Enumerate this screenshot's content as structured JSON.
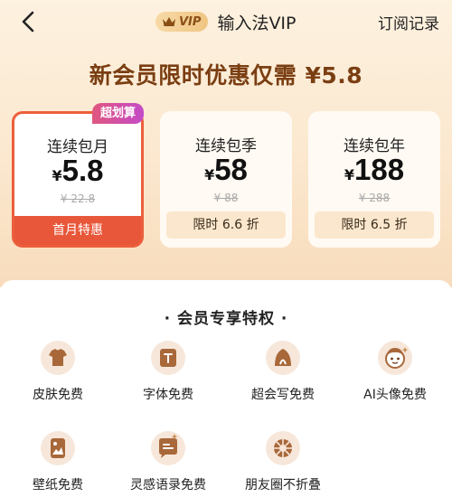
{
  "nav": {
    "vip_badge": "VIP",
    "title": "输入法VIP",
    "right_link": "订阅记录"
  },
  "headline": "新会员限时优惠仅需 ¥5.8",
  "plans": [
    {
      "name": "连续包月",
      "currency": "¥",
      "price": "5.8",
      "original": "¥ 22.8",
      "tag": "首月特惠",
      "ribbon": "超划算",
      "selected": true
    },
    {
      "name": "连续包季",
      "currency": "¥",
      "price": "58",
      "original": "¥ 88",
      "tag": "限时 6.6 折",
      "selected": false
    },
    {
      "name": "连续包年",
      "currency": "¥",
      "price": "188",
      "original": "¥ 288",
      "tag": "限时 6.5 折",
      "selected": false
    }
  ],
  "benefits_title": "· 会员专享特权 ·",
  "benefits": [
    {
      "label": "皮肤免费",
      "icon": "tshirt-icon"
    },
    {
      "label": "字体免费",
      "icon": "font-icon"
    },
    {
      "label": "超会写免费",
      "icon": "writing-icon"
    },
    {
      "label": "AI头像免费",
      "icon": "ai-avatar-icon"
    },
    {
      "label": "壁纸免费",
      "icon": "wallpaper-icon"
    },
    {
      "label": "灵感语录免费",
      "icon": "quote-icon"
    },
    {
      "label": "朋友圈不折叠",
      "icon": "moments-icon"
    }
  ],
  "colors": {
    "accent": "#ec5f3c",
    "headline": "#7a3e12",
    "icon_brown": "#a8683a"
  }
}
